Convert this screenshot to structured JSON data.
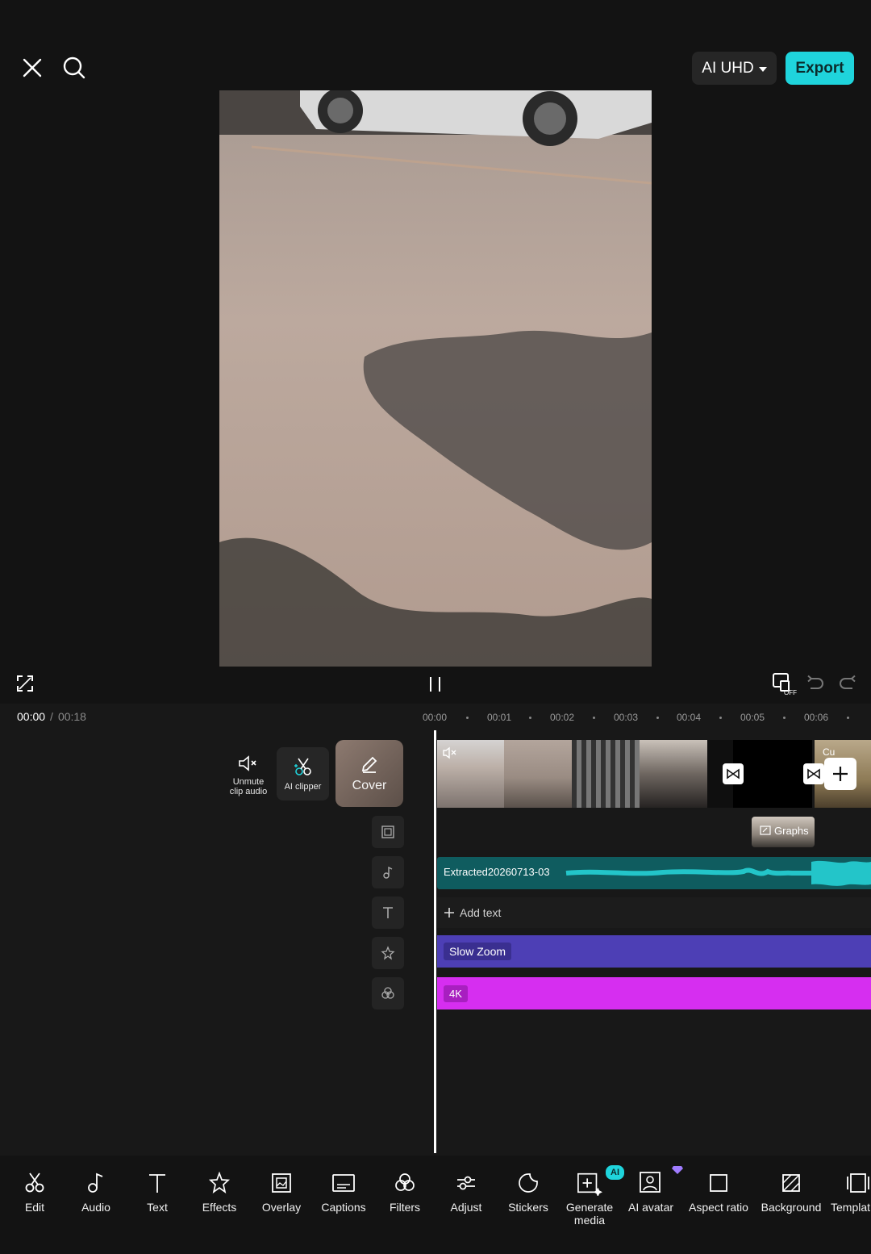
{
  "header": {
    "quality_label": "AI UHD",
    "export_label": "Export"
  },
  "playback": {
    "current_time": "00:00",
    "separator": "/",
    "total_time": "00:18"
  },
  "ruler": {
    "ticks": [
      "00:00",
      "00:01",
      "00:02",
      "00:03",
      "00:04",
      "00:05",
      "00:06"
    ]
  },
  "side_actions": {
    "unmute_label_line1": "Unmute",
    "unmute_label_line2": "clip audio",
    "clipper_label": "AI clipper",
    "cover_label": "Cover"
  },
  "tracks": {
    "overlay_clip_label": "Graphs",
    "audio_clip_label": "Extracted20260713-03",
    "add_text_label": "Add text",
    "effect_label": "Slow Zoom",
    "filter_label": "4K",
    "clip_cut_label": "Cu"
  },
  "bottom_nav": {
    "items": [
      {
        "label": "Edit",
        "icon": "scissors-icon"
      },
      {
        "label": "Audio",
        "icon": "music-note-icon"
      },
      {
        "label": "Text",
        "icon": "text-icon"
      },
      {
        "label": "Effects",
        "icon": "effects-star-icon"
      },
      {
        "label": "Overlay",
        "icon": "overlay-image-icon"
      },
      {
        "label": "Captions",
        "icon": "captions-icon"
      },
      {
        "label": "Filters",
        "icon": "filters-icon"
      },
      {
        "label": "Adjust",
        "icon": "adjust-sliders-icon"
      },
      {
        "label": "Stickers",
        "icon": "sticker-icon"
      },
      {
        "label": "Generate\nmedia",
        "icon": "generate-media-icon"
      },
      {
        "label": "AI avatar",
        "icon": "ai-avatar-icon"
      },
      {
        "label": "Aspect ratio",
        "icon": "aspect-ratio-icon"
      },
      {
        "label": "Background",
        "icon": "background-icon"
      },
      {
        "label": "Templat",
        "icon": "template-icon"
      }
    ],
    "generate_badge": "AI"
  },
  "colors": {
    "accent": "#1fd4dc",
    "audio_track": "#0f5c5f",
    "effect_track": "#4d3fb5",
    "filter_track": "#d62ef0"
  }
}
